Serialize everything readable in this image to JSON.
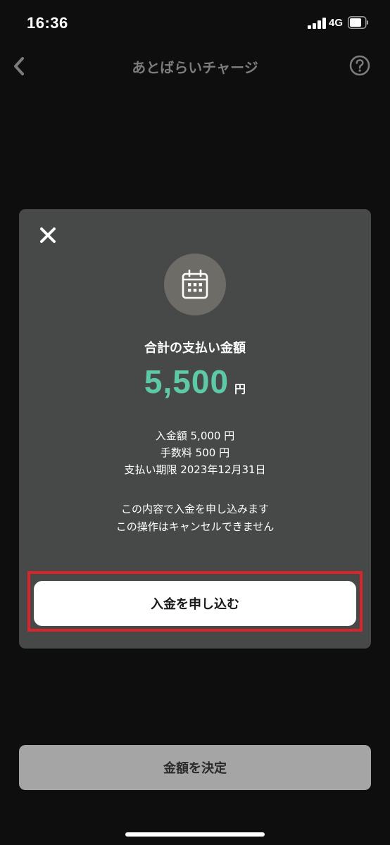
{
  "status_bar": {
    "time": "16:36",
    "network": "4G"
  },
  "header": {
    "title": "あとばらいチャージ",
    "back_icon": "chevron-left-icon",
    "help_icon": "question-circle-icon"
  },
  "modal": {
    "close_icon": "close-icon",
    "illustration_icon": "calendar-icon",
    "total_label": "合計の支払い金額",
    "amount": "5,500",
    "amount_unit": "円",
    "details": [
      "入金額 5,000 円",
      "手数料 500 円",
      "支払い期限 2023年12月31日"
    ],
    "notices": [
      "この内容で入金を申し込みます",
      "この操作はキャンセルできません"
    ],
    "submit_label": "入金を申し込む"
  },
  "footer": {
    "confirm_label": "金額を決定"
  },
  "colors": {
    "background": "#0d0e0d",
    "modal": "#474948",
    "amount_accent": "#5dc9a7",
    "highlight": "#d8252b",
    "confirm_disabled": "#a5a5a5"
  }
}
